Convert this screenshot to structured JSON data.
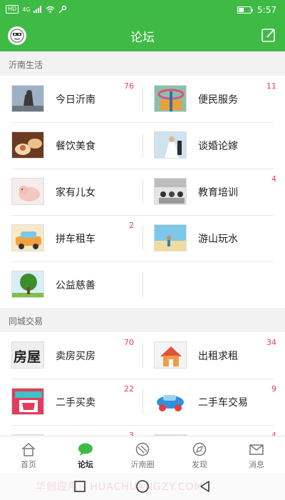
{
  "status_bar": {
    "network": "HD",
    "signal_text": "4G",
    "time": "5:57"
  },
  "header": {
    "title": "论坛"
  },
  "sections": [
    {
      "title": "沂南生活",
      "items": [
        {
          "label": "今日沂南",
          "count": "76",
          "image": "statue-photo"
        },
        {
          "label": "便民服务",
          "count": "11",
          "image": "road-sign-photo"
        },
        {
          "label": "餐饮美食",
          "count": "",
          "image": "food-photo"
        },
        {
          "label": "谈婚论嫁",
          "count": "",
          "image": "wedding-photo"
        },
        {
          "label": "家有儿女",
          "count": "",
          "image": "baby-photo"
        },
        {
          "label": "教育培训",
          "count": "4",
          "image": "classroom-photo"
        },
        {
          "label": "拼车租车",
          "count": "2",
          "image": "car-cartoon"
        },
        {
          "label": "游山玩水",
          "count": "",
          "image": "beach-photo"
        },
        {
          "label": "公益慈善",
          "count": "",
          "image": "tree-photo"
        }
      ]
    },
    {
      "title": "同城交易",
      "items": [
        {
          "label": "卖房买房",
          "count": "70",
          "image": "house-characters"
        },
        {
          "label": "出租求租",
          "count": "34",
          "image": "house-icon"
        },
        {
          "label": "二手买卖",
          "count": "22",
          "image": "shop-icon"
        },
        {
          "label": "二手车交易",
          "count": "9",
          "image": "toy-car"
        },
        {
          "label": "",
          "count": "3",
          "image": "partial"
        },
        {
          "label": "",
          "count": "4",
          "image": "partial"
        }
      ]
    }
  ],
  "tabs": [
    {
      "label": "首页",
      "icon": "home-icon",
      "active": false
    },
    {
      "label": "论坛",
      "icon": "chat-icon",
      "active": true
    },
    {
      "label": "沂南圈",
      "icon": "circle-icon",
      "active": false
    },
    {
      "label": "发现",
      "icon": "compass-icon",
      "active": false
    },
    {
      "label": "消息",
      "icon": "mail-icon",
      "active": false
    }
  ],
  "watermark": "华创应用 · HUACHUANGZY.COM",
  "colors": {
    "brand_green": "#3fbb45",
    "count_red": "#e0405a",
    "background": "#f2f2f2"
  }
}
